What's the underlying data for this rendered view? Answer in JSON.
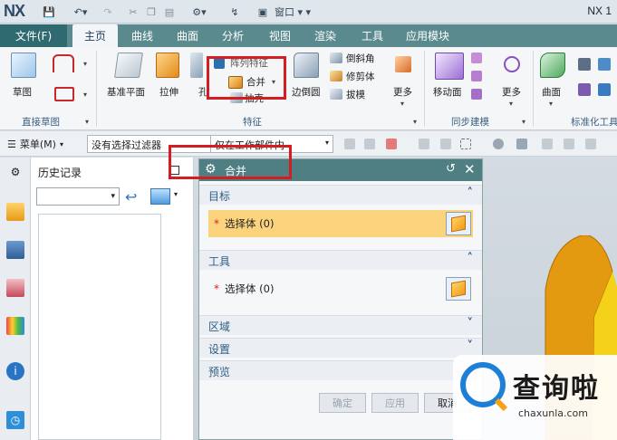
{
  "titlebar": {
    "logo": "NX",
    "window_menu": "窗口",
    "title_right": "NX 1"
  },
  "tabs": {
    "file": "文件(F)",
    "items": [
      "主页",
      "曲线",
      "曲面",
      "分析",
      "视图",
      "渲染",
      "工具",
      "应用模块"
    ],
    "active": "主页"
  },
  "ribbon": {
    "sketch_label": "草图",
    "direct_sketch_group": "直接草图",
    "datum_plane": "基准平面",
    "extrude": "拉伸",
    "hole_partial": "孔",
    "array_feature": "阵列特征",
    "unite": "合并",
    "shell": "抽壳",
    "edge_blend": "边倒圆",
    "chamfer": "倒斜角",
    "trim_body": "修剪体",
    "draft": "拔模",
    "more": "更多",
    "feature_group": "特征",
    "move_face": "移动面",
    "sync_more": "更多",
    "sync_group": "同步建模",
    "surface": "曲面",
    "std_group": "标准化工具"
  },
  "toolbar": {
    "menu": "菜单(M)",
    "filter": "没有选择过滤器",
    "scope": "仅在工作部件内"
  },
  "history": {
    "title": "历史记录"
  },
  "dialog": {
    "title": "合并",
    "section_target": "目标",
    "target_select": "选择体 (0)",
    "section_tool": "工具",
    "tool_select": "选择体 (0)",
    "section_region": "区域",
    "section_settings": "设置",
    "section_preview": "预览",
    "ok": "确定",
    "apply": "应用",
    "cancel": "取消"
  },
  "watermark": {
    "text": "查询啦",
    "url": "chaxunla.com"
  },
  "colors": {
    "tab_bar": "#5b8a8e",
    "dialog_title": "#4f7f82",
    "highlight_row": "#fbd37c",
    "red_box": "#d21d22",
    "part": "#e39a10"
  }
}
